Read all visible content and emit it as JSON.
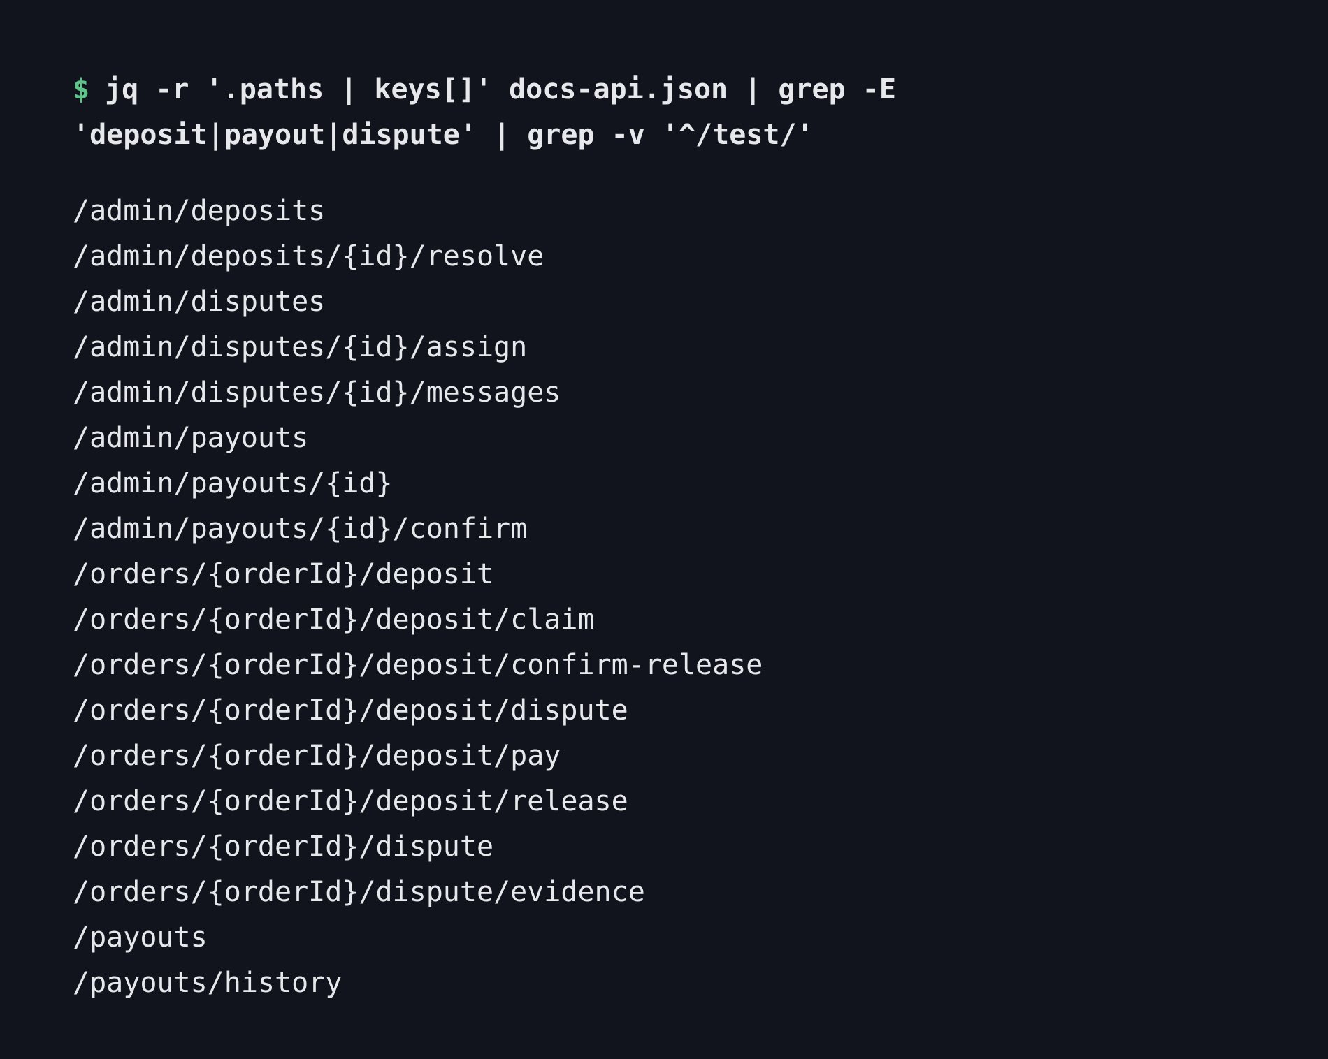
{
  "terminal": {
    "prompt_symbol": "$",
    "command_part1": "jq -r '.paths | keys[]' docs-api.json | grep -E",
    "command_part2": "'deposit|payout|dispute' | grep -v '^/test/'",
    "output_lines": [
      "/admin/deposits",
      "/admin/deposits/{id}/resolve",
      "/admin/disputes",
      "/admin/disputes/{id}/assign",
      "/admin/disputes/{id}/messages",
      "/admin/payouts",
      "/admin/payouts/{id}",
      "/admin/payouts/{id}/confirm",
      "/orders/{orderId}/deposit",
      "/orders/{orderId}/deposit/claim",
      "/orders/{orderId}/deposit/confirm-release",
      "/orders/{orderId}/deposit/dispute",
      "/orders/{orderId}/deposit/pay",
      "/orders/{orderId}/deposit/release",
      "/orders/{orderId}/dispute",
      "/orders/{orderId}/dispute/evidence",
      "/payouts",
      "/payouts/history"
    ],
    "colors": {
      "background": "#11141c",
      "text": "#e6e8ec",
      "prompt": "#5ec58a"
    }
  }
}
